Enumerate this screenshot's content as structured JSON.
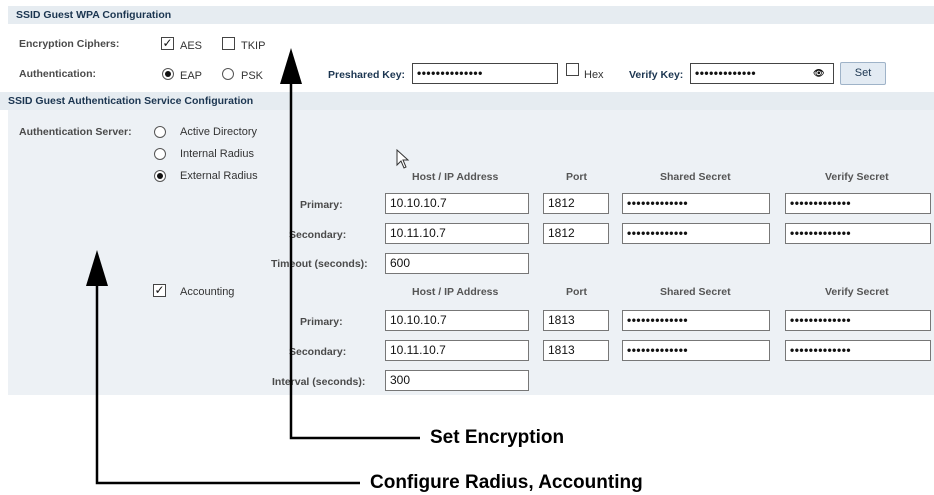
{
  "wpa": {
    "header": "SSID Guest  WPA Configuration",
    "encryption_ciphers_label": "Encryption Ciphers:",
    "cipher_aes": "AES",
    "cipher_tkip": "TKIP",
    "authentication_label": "Authentication:",
    "auth_eap": "EAP",
    "auth_psk": "PSK",
    "preshared_key_label": "Preshared Key:",
    "preshared_key_value": "••••••••••••••",
    "hex_label": "Hex",
    "verify_key_label": "Verify Key:",
    "verify_key_value": "•••••••••••••",
    "set_button": "Set"
  },
  "auth_service": {
    "header": "SSID Guest  Authentication Service Configuration",
    "auth_server_label": "Authentication Server:",
    "options": [
      "Active Directory",
      "Internal Radius",
      "External Radius"
    ],
    "selected_option": "External Radius",
    "columns": {
      "host": "Host / IP Address",
      "port": "Port",
      "shared_secret": "Shared Secret",
      "verify_secret": "Verify Secret"
    },
    "radius": {
      "primary_label": "Primary:",
      "primary_host": "10.10.10.7",
      "primary_port": "1812",
      "primary_secret": "•••••••••••••",
      "primary_verify": "•••••••••••••",
      "secondary_label": "Secondary:",
      "secondary_host": "10.11.10.7",
      "secondary_port": "1812",
      "secondary_secret": "•••••••••••••",
      "secondary_verify": "•••••••••••••",
      "timeout_label": "Timeout (seconds):",
      "timeout_value": "600"
    },
    "accounting_label": "Accounting",
    "accounting_checked": true,
    "accounting": {
      "primary_label": "Primary:",
      "primary_host": "10.10.10.7",
      "primary_port": "1813",
      "primary_secret": "•••••••••••••",
      "primary_verify": "•••••••••••••",
      "secondary_label": "Secondary:",
      "secondary_host": "10.11.10.7",
      "secondary_port": "1813",
      "secondary_secret": "•••••••••••••",
      "secondary_verify": "•••••••••••••",
      "interval_label": "Interval (seconds):",
      "interval_value": "300"
    }
  },
  "callouts": {
    "set_encryption": "Set Encryption",
    "configure_radius": "Configure Radius, Accounting"
  }
}
